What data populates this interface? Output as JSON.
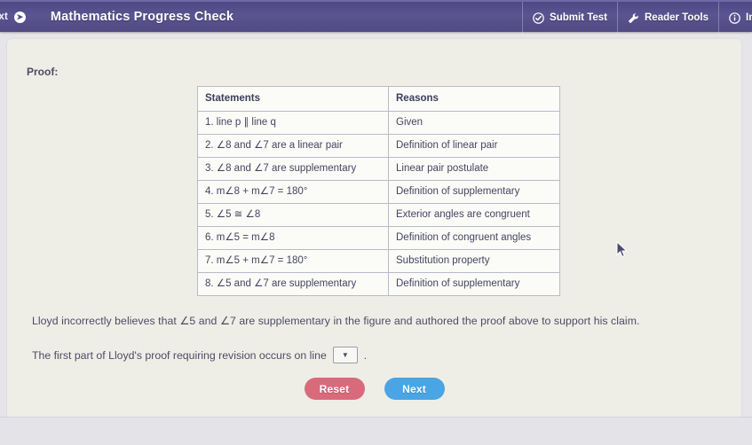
{
  "topbar": {
    "left_item_label": "ext",
    "left_item_icon": "circle-arrow-right-icon",
    "app_title": "Mathematics Progress Check",
    "right_items": [
      {
        "label": "Submit Test",
        "icon": "check-circle-icon"
      },
      {
        "label": "Reader Tools",
        "icon": "wrench-icon"
      },
      {
        "label": "In",
        "icon": "info-circle-icon"
      }
    ]
  },
  "content": {
    "proof_label": "Proof:",
    "table": {
      "headers": [
        "Statements",
        "Reasons"
      ],
      "rows": [
        {
          "statement": "1. line p ∥ line q",
          "reason": "Given"
        },
        {
          "statement": "2. ∠8 and ∠7 are a linear pair",
          "reason": "Definition of linear pair"
        },
        {
          "statement": "3. ∠8 and ∠7 are supplementary",
          "reason": "Linear pair postulate"
        },
        {
          "statement": "4. m∠8 + m∠7 = 180°",
          "reason": "Definition of supplementary"
        },
        {
          "statement": "5. ∠5 ≅ ∠8",
          "reason": "Exterior angles are congruent"
        },
        {
          "statement": "6. m∠5 = m∠8",
          "reason": "Definition of congruent angles"
        },
        {
          "statement": "7. m∠5 + m∠7 = 180°",
          "reason": "Substitution property"
        },
        {
          "statement": "8. ∠5 and ∠7 are supplementary",
          "reason": "Definition of supplementary"
        }
      ]
    },
    "prompt_1": "Lloyd incorrectly believes that ∠5 and ∠7 are supplementary in the figure and authored the proof above to support his claim.",
    "prompt_2": "The first part of Lloyd's proof requiring revision occurs on line",
    "prompt_2_end": ".",
    "line_select_value": "",
    "buttons": {
      "reset_label": "Reset",
      "next_label": "Next"
    }
  },
  "colors": {
    "header_purple": "#5a5490",
    "reset_red": "#d96a7c",
    "next_blue": "#49a5e4",
    "card_background": "#efeee6",
    "table_border": "#b9bacb"
  }
}
